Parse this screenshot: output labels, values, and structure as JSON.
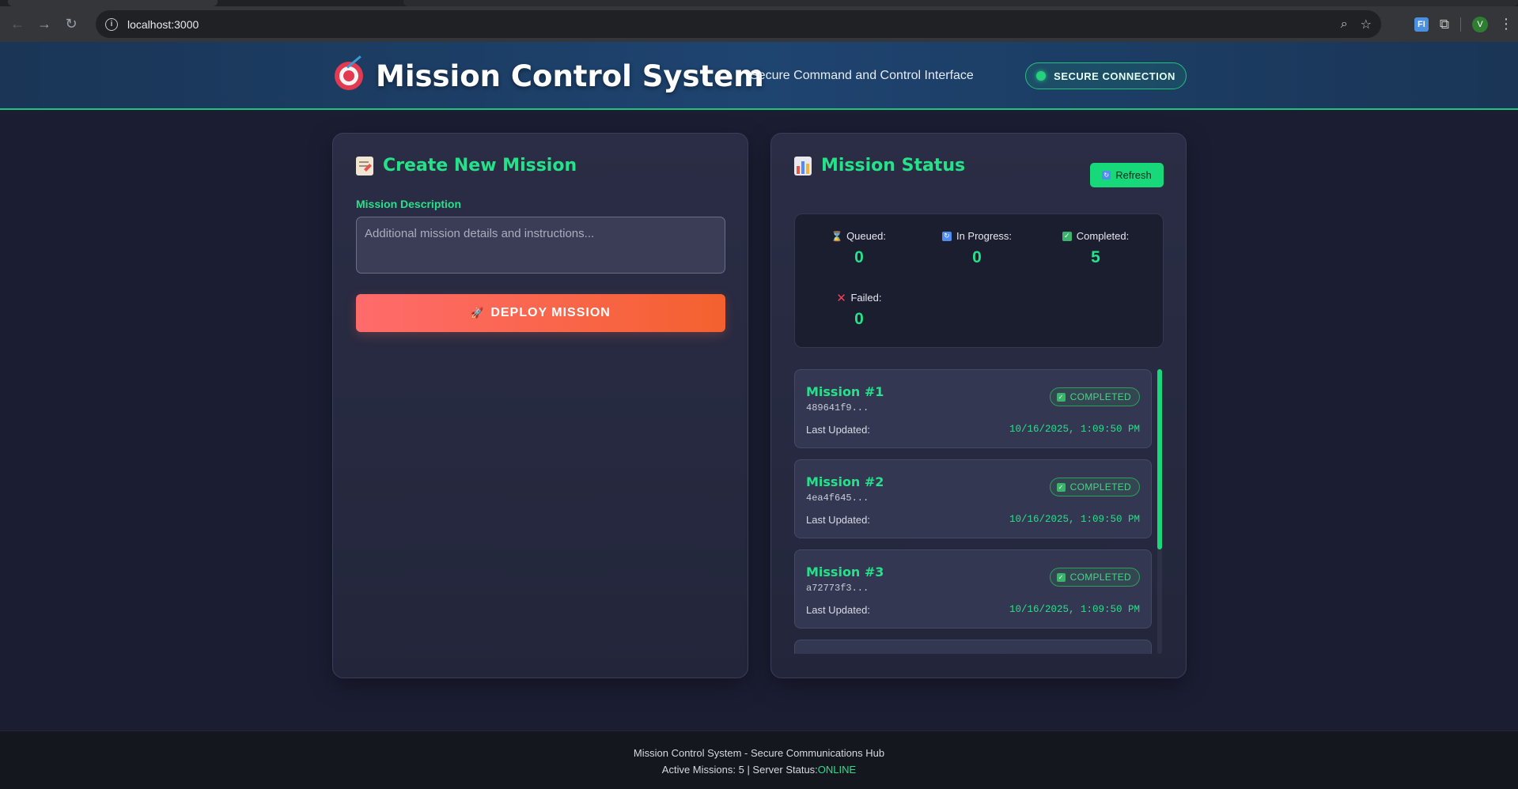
{
  "browser": {
    "url": "localhost:3000",
    "profile_initial": "V",
    "extension_badge": "FI"
  },
  "header": {
    "title": "Mission Control System",
    "subtitle": "Secure Command and Control Interface",
    "connection_badge": "SECURE CONNECTION",
    "accent_color": "#26e08a"
  },
  "create_panel": {
    "title": "Create New Mission",
    "field_label": "Mission Description",
    "description_placeholder": "Additional mission details and instructions...",
    "deploy_label": "DEPLOY MISSION"
  },
  "status_panel": {
    "title": "Mission Status",
    "refresh_label": "Refresh",
    "stats": {
      "queued_label": "Queued:",
      "queued_value": "0",
      "in_progress_label": "In Progress:",
      "in_progress_value": "0",
      "completed_label": "Completed:",
      "completed_value": "5",
      "failed_label": "Failed:",
      "failed_value": "0"
    },
    "missions": [
      {
        "title": "Mission #1",
        "id": "489641f9...",
        "status": "COMPLETED",
        "updated_label": "Last Updated:",
        "updated": "10/16/2025, 1:09:50 PM"
      },
      {
        "title": "Mission #2",
        "id": "4ea4f645...",
        "status": "COMPLETED",
        "updated_label": "Last Updated:",
        "updated": "10/16/2025, 1:09:50 PM"
      },
      {
        "title": "Mission #3",
        "id": "a72773f3...",
        "status": "COMPLETED",
        "updated_label": "Last Updated:",
        "updated": "10/16/2025, 1:09:50 PM"
      }
    ]
  },
  "footer": {
    "line1": "Mission Control System - Secure Communications Hub",
    "line2_prefix": "Active Missions: 5 | Server Status:",
    "server_status": "ONLINE"
  }
}
